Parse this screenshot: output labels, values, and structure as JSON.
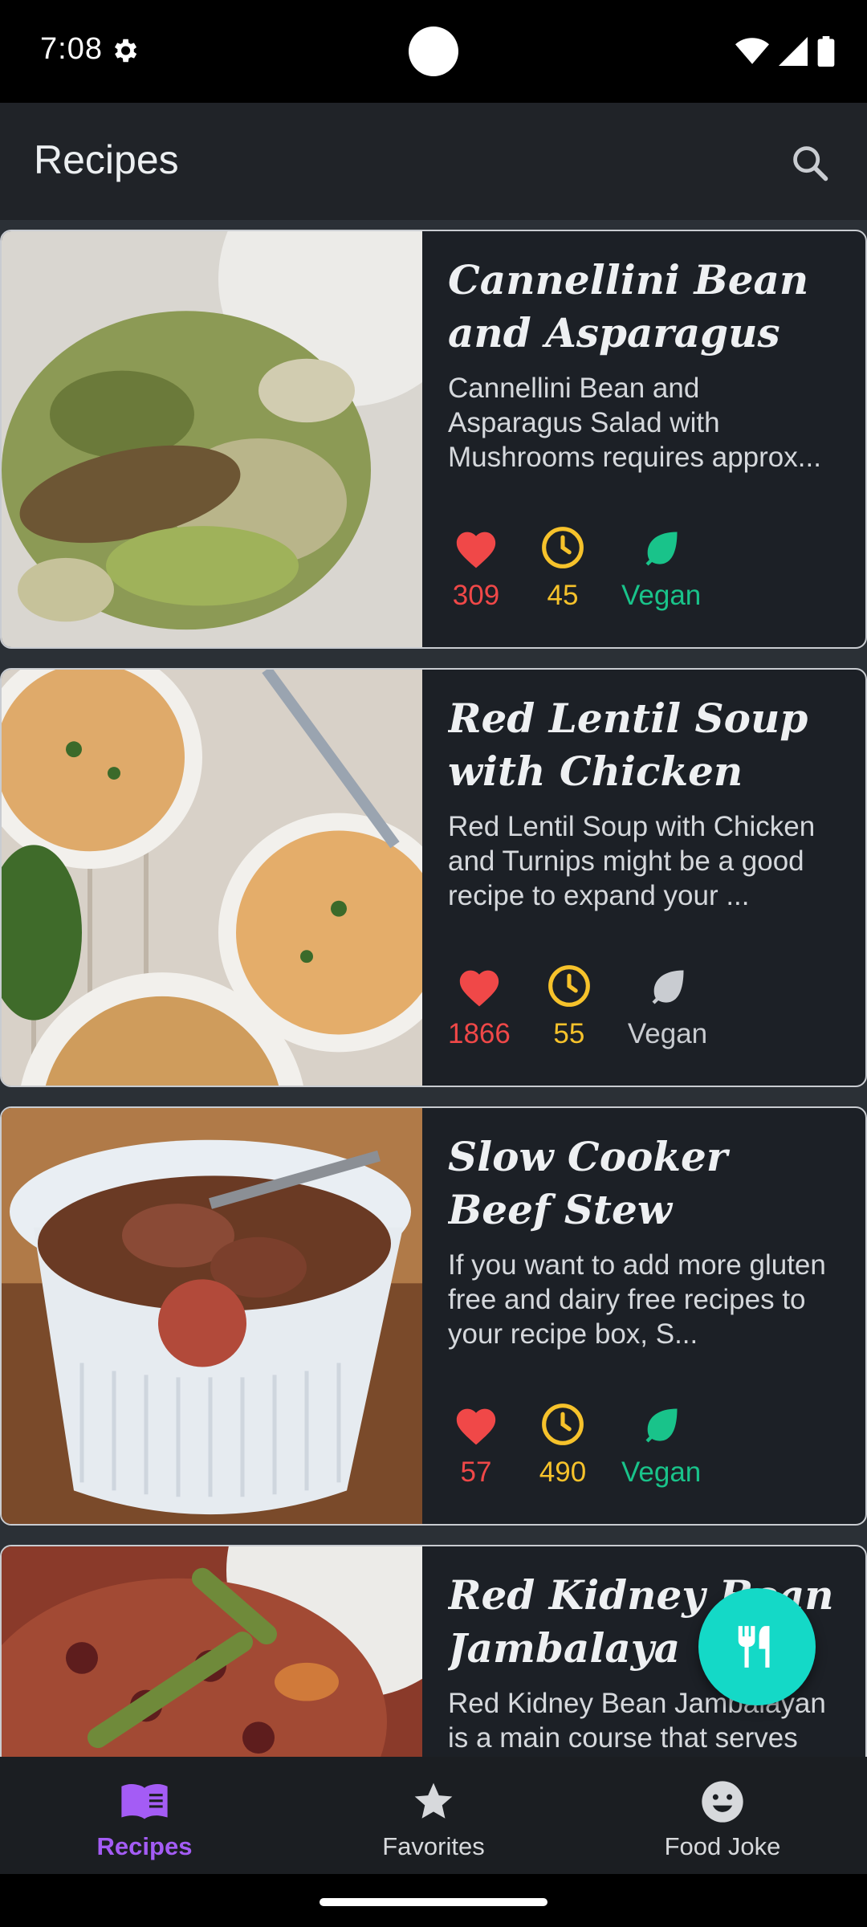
{
  "status_bar": {
    "time": "7:08"
  },
  "app_bar": {
    "title": "Recipes"
  },
  "recipes": [
    {
      "title": "Cannellini Bean and Asparagus Salad w...",
      "description": "Cannellini Bean and Asparagus Salad with Mushrooms requires approx...",
      "likes": "309",
      "minutes": "45",
      "vegan_label": "Vegan",
      "vegan": true
    },
    {
      "title": "Red Lentil Soup with Chicken and Turnips",
      "description": "Red Lentil Soup with Chicken and Turnips might be a good recipe to expand your ...",
      "likes": "1866",
      "minutes": "55",
      "vegan_label": "Vegan",
      "vegan": false
    },
    {
      "title": "Slow Cooker Beef Stew",
      "description": "If you want to add more gluten free and dairy free recipes to your recipe box, S...",
      "likes": "57",
      "minutes": "490",
      "vegan_label": "Vegan",
      "vegan": true
    },
    {
      "title": "Red Kidney Bean Jambalaya",
      "description": "Red Kidney Bean Jambalayan is a main course that serves"
    }
  ],
  "bottom_nav": {
    "items": [
      {
        "label": "Recipes",
        "icon": "menu-book-icon",
        "active": true
      },
      {
        "label": "Favorites",
        "icon": "star-icon",
        "active": false
      },
      {
        "label": "Food Joke",
        "icon": "smiley-icon",
        "active": false
      }
    ]
  },
  "fab": {
    "icon": "restaurant-icon"
  },
  "colors": {
    "like": "#f04848",
    "time": "#f6c22b",
    "vegan": "#19c38a",
    "not_vegan": "#c9ccd1",
    "accent_nav": "#a45cf5",
    "fab": "#14d9c7"
  }
}
